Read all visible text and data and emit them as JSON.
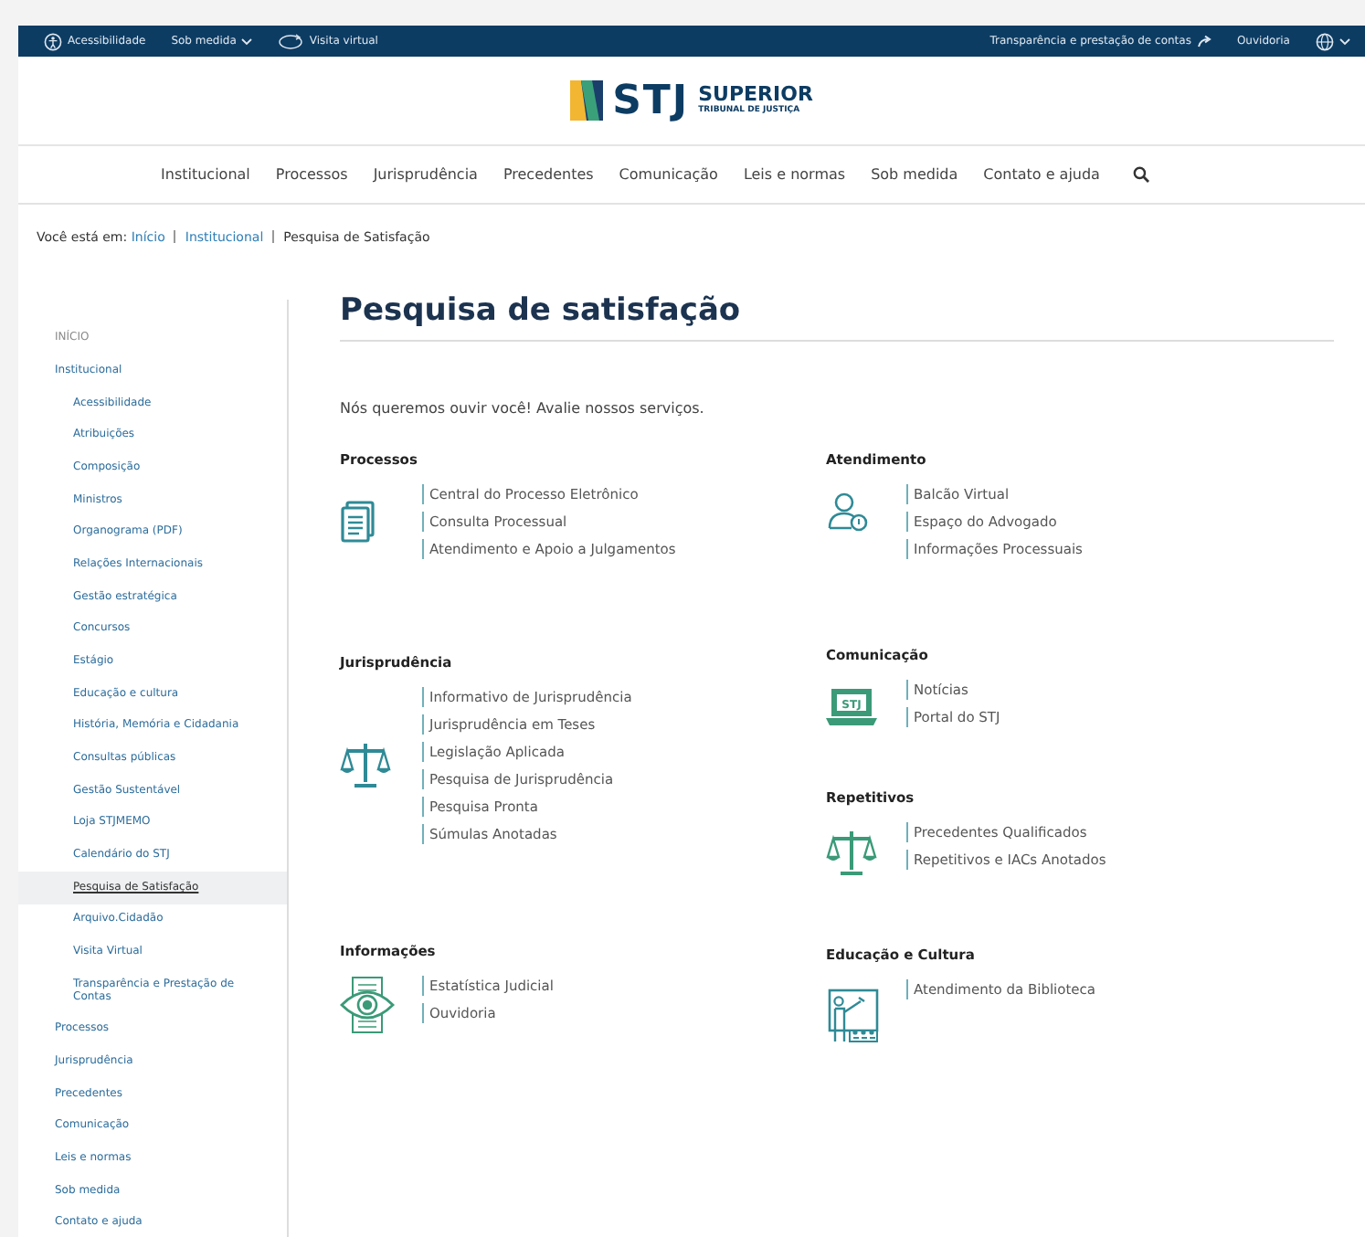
{
  "top_bar": {
    "left": [
      {
        "kind": "accessibility",
        "label": "Acessibilidade"
      },
      {
        "kind": "dropdown",
        "label": "Sob medida"
      },
      {
        "kind": "tour",
        "label": "Visita virtual"
      }
    ],
    "right": [
      {
        "kind": "arrow",
        "label": "Transparência e prestação de contas"
      },
      {
        "kind": "plain",
        "label": "Ouvidoria"
      },
      {
        "kind": "globe"
      }
    ]
  },
  "logo": {
    "short": "STJ",
    "name": "SUPERIOR",
    "subtitle": "TRIBUNAL DE JUSTIÇA"
  },
  "nav": [
    "Institucional",
    "Processos",
    "Jurisprudência",
    "Precedentes",
    "Comunicação",
    "Leis e normas",
    "Sob medida",
    "Contato e ajuda"
  ],
  "breadcrumb": {
    "prefix": "Você está em:",
    "links": [
      "Início",
      "Institucional"
    ],
    "current": "Pesquisa de Satisfação"
  },
  "sidebar": {
    "items": [
      {
        "label": "INÍCIO",
        "selected": false
      },
      {
        "label": "Institucional",
        "selected": false,
        "children": [
          {
            "label": "Acessibilidade",
            "selected": false
          },
          {
            "label": "Atribuições",
            "selected": false
          },
          {
            "label": "Composição",
            "selected": false
          },
          {
            "label": "Ministros",
            "selected": false
          },
          {
            "label": "Organograma (PDF)",
            "selected": false
          },
          {
            "label": "Relações Internacionais",
            "selected": false
          },
          {
            "label": "Gestão estratégica",
            "selected": false
          },
          {
            "label": "Concursos",
            "selected": false
          },
          {
            "label": "Estágio",
            "selected": false
          },
          {
            "label": "Educação e cultura",
            "selected": false
          },
          {
            "label": "História, Memória e Cidadania",
            "selected": false
          },
          {
            "label": "Consultas públicas",
            "selected": false
          },
          {
            "label": "Gestão Sustentável",
            "selected": false
          },
          {
            "label": "Loja STJMEMO",
            "selected": false
          },
          {
            "label": "Calendário do STJ",
            "selected": false
          },
          {
            "label": "Pesquisa de Satisfação",
            "selected": true
          },
          {
            "label": "Arquivo.Cidadão",
            "selected": false
          },
          {
            "label": "Visita Virtual",
            "selected": false
          },
          {
            "label": "Transparência e Prestação de Contas",
            "selected": false
          }
        ]
      },
      {
        "label": "Processos",
        "selected": false
      },
      {
        "label": "Jurisprudência",
        "selected": false
      },
      {
        "label": "Precedentes",
        "selected": false
      },
      {
        "label": "Comunicação",
        "selected": false
      },
      {
        "label": "Leis e normas",
        "selected": false
      },
      {
        "label": "Sob medida",
        "selected": false
      },
      {
        "label": "Contato e ajuda",
        "selected": false
      }
    ]
  },
  "page": {
    "title": "Pesquisa de satisfação",
    "intro": "Nós queremos ouvir você! Avalie nossos serviços."
  },
  "columns": [
    [
      {
        "title": "Processos",
        "kind": "document",
        "links": [
          "Central do Processo Eletrônico",
          "Consulta Processual",
          "Atendimento e Apoio a Julgamentos"
        ]
      },
      {
        "title": "Jurisprudência",
        "kind": "scale",
        "links": [
          "Informativo de Jurisprudência",
          "Jurisprudência em Teses",
          "Legislação Aplicada",
          "Pesquisa de Jurisprudência",
          "Pesquisa Pronta",
          "Súmulas Anotadas"
        ]
      },
      {
        "title": "Informações",
        "kind": "eye",
        "links": [
          "Estatística Judicial",
          "Ouvidoria"
        ]
      }
    ],
    [
      {
        "title": "Atendimento",
        "kind": "person",
        "links": [
          "Balcão Virtual",
          "Espaço do Advogado",
          "Informações Processuais"
        ]
      },
      {
        "title": "Comunicação",
        "kind": "laptop",
        "laptop_text": "STJ",
        "links": [
          "Notícias",
          "Portal do STJ"
        ]
      },
      {
        "title": "Repetitivos",
        "kind": "scale-green",
        "links": [
          "Precedentes Qualificados",
          "Repetitivos e IACs Anotados"
        ]
      },
      {
        "title": "Educação e Cultura",
        "kind": "teacher",
        "links": [
          "Atendimento da Biblioteca"
        ]
      }
    ]
  ]
}
